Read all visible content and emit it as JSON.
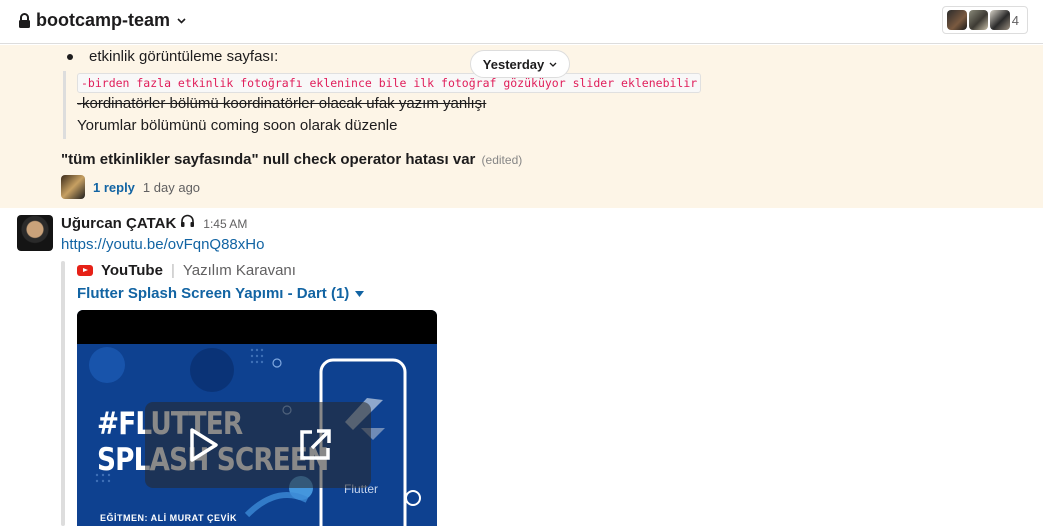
{
  "header": {
    "channel_name": "bootcamp-team",
    "member_count": "4"
  },
  "thread": {
    "bullet_text": "etkinlik görüntüleme sayfası:",
    "code_text": "-birden fazla etkinlik fotoğrafı eklenince bile ilk fotoğraf gözüküyor slider eklenebilir",
    "strike_text": "-kordinatörler bölümü koordinatörler olacak ufak yazım yanlışı",
    "plain_text": "Yorumlar bölümünü coming soon olarak düzenle",
    "message_text": "\"tüm etkinlikler sayfasında\" null check operator hatası var",
    "edited_label": "(edited)",
    "reply_label": "1 reply",
    "reply_time": "1 day ago"
  },
  "date_divider": {
    "label": "Yesterday"
  },
  "message": {
    "sender": "Uğurcan ÇATAK",
    "time": "1:45 AM",
    "link": "https://youtu.be/ovFqnQ88xHo",
    "attachment": {
      "service": "YouTube",
      "separator": "|",
      "channel": "Yazılım Karavanı",
      "title": "Flutter Splash Screen Yapımı - Dart (1)",
      "thumbnail_heading_1": "#FLUTTER",
      "thumbnail_heading_2": "SPLASH SCREEN",
      "thumbnail_footer": "EĞİTMEN: ALİ MURAT ÇEVİK",
      "thumbnail_logo_word": "Flutter"
    }
  },
  "icons": {
    "lock": "lock-icon",
    "channel_menu": "chevron-down-icon",
    "headphones": "headphones-icon",
    "youtube": "youtube-icon",
    "play": "play-icon",
    "open_external": "external-link-icon"
  },
  "colors": {
    "link": "#1264a3",
    "highlight_bg": "#fdf5e7",
    "code": "#e01e5a",
    "youtube_red": "#e62117",
    "thumbnail_blue": "#0d3c82"
  }
}
